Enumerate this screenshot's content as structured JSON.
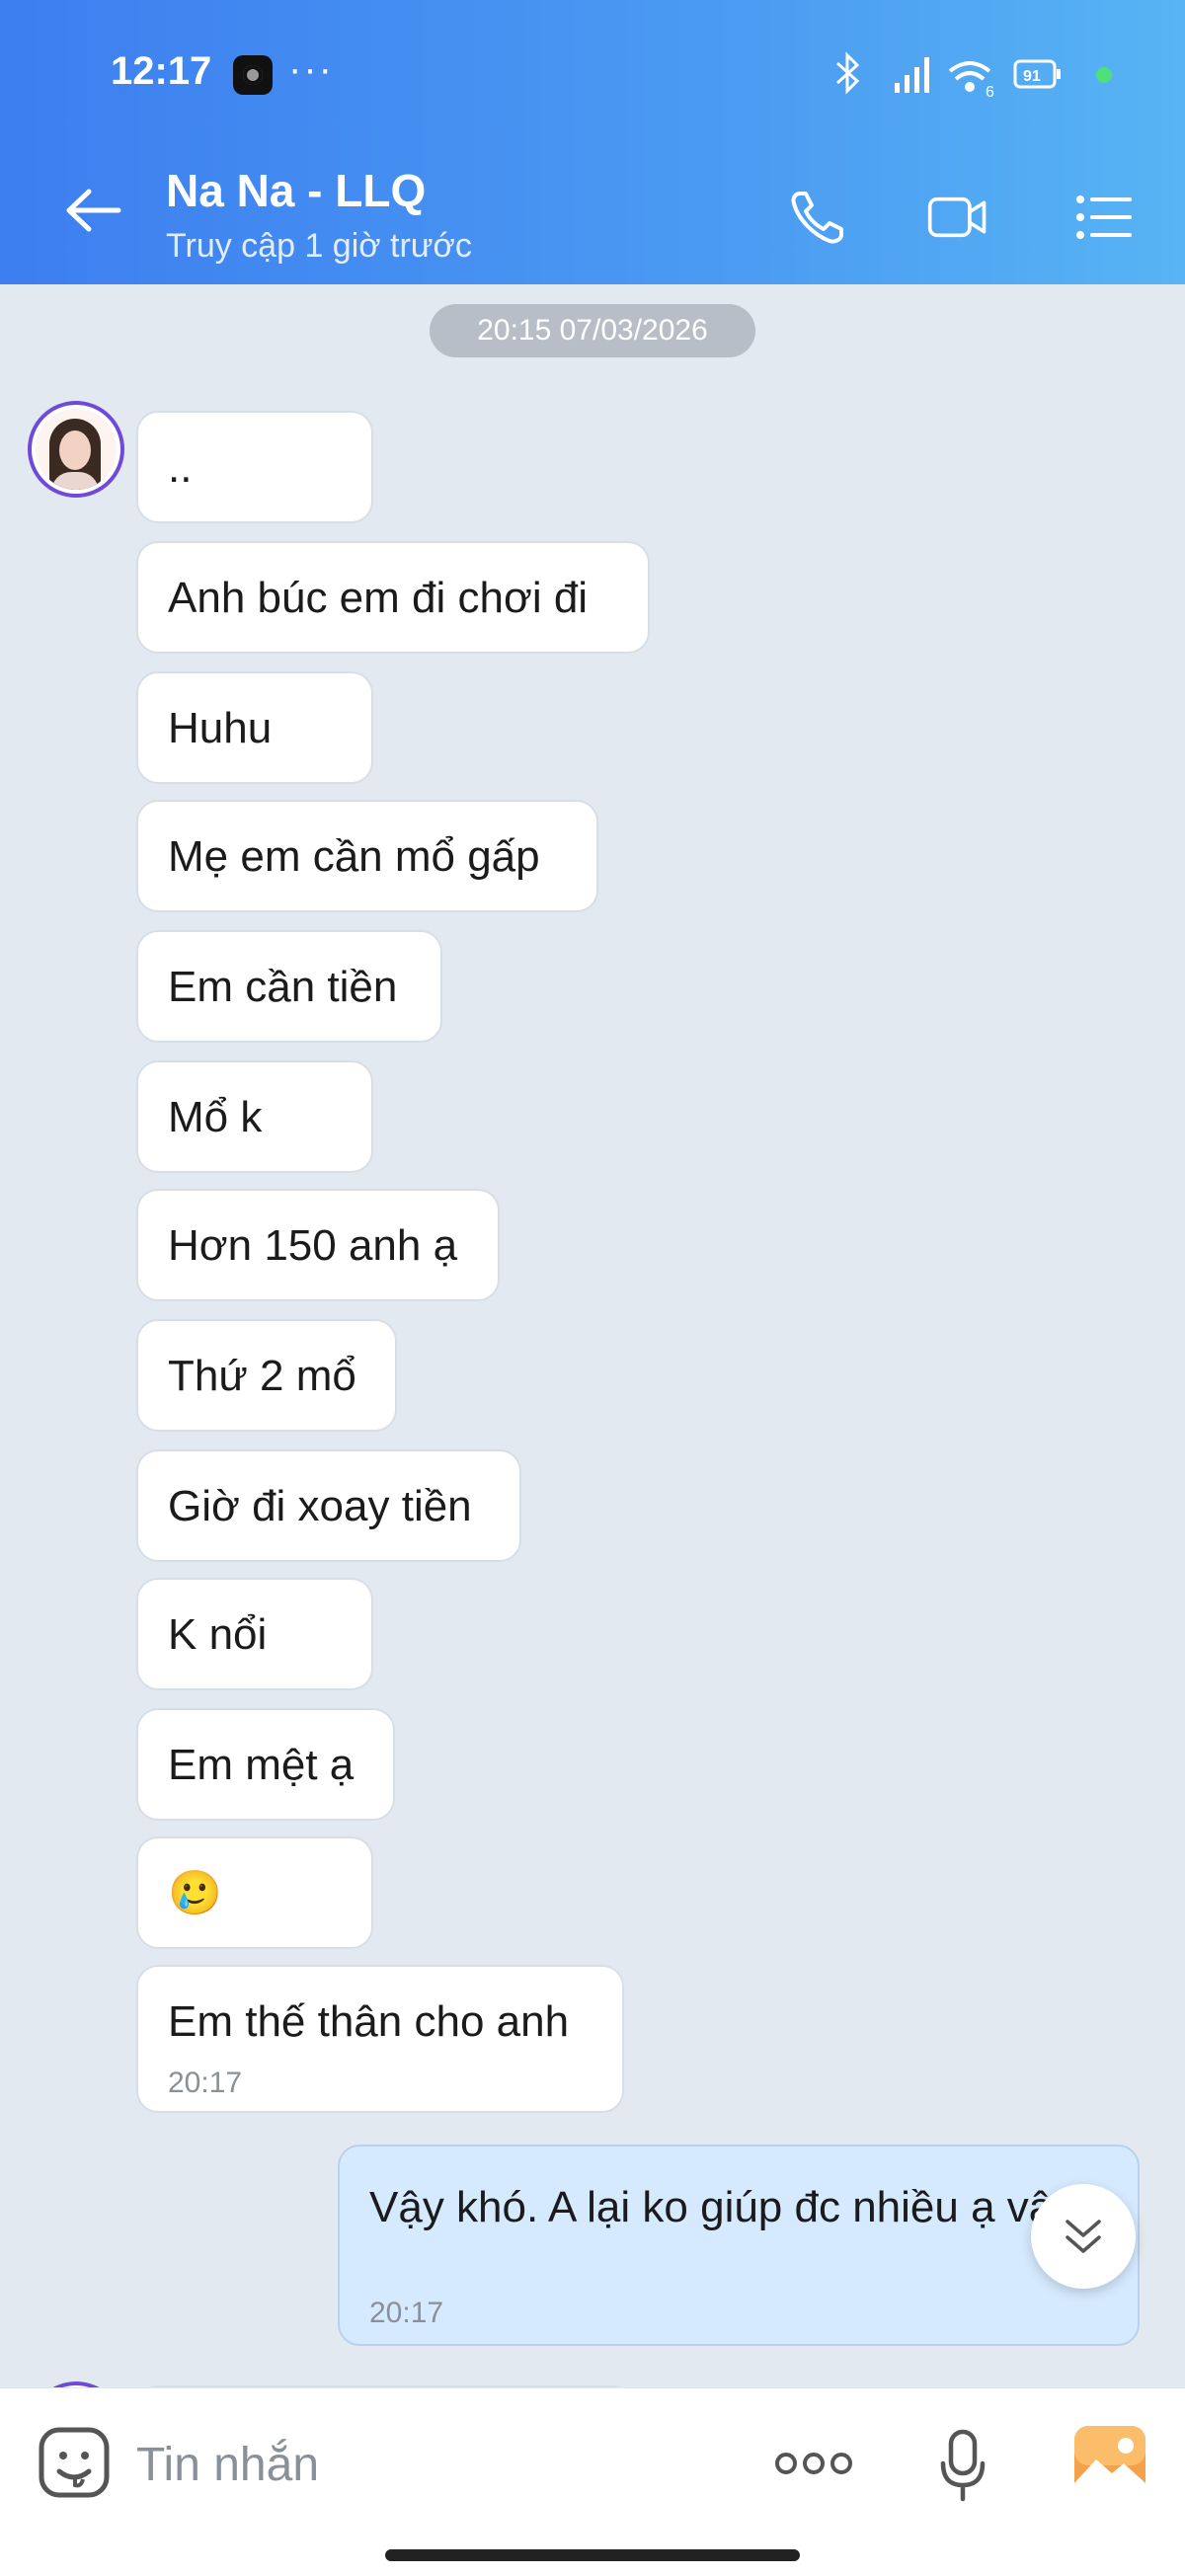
{
  "status_bar": {
    "time": "12:17",
    "more": "···",
    "battery": "91",
    "network": "6"
  },
  "header": {
    "title": "Na Na - LLQ",
    "subtitle": "Truy cập 1 giờ trước",
    "icons": [
      "back-arrow-icon",
      "phone-icon",
      "video-camera-icon",
      "list-menu-icon"
    ]
  },
  "chat": {
    "date_separator": "20:15 07/03/2026",
    "incoming": [
      {
        "text": ".."
      },
      {
        "text": "Anh búc em đi chơi đi"
      },
      {
        "text": "Huhu"
      },
      {
        "text": "Mẹ em cần mổ gấp"
      },
      {
        "text": "Em cần tiền"
      },
      {
        "text": "Mổ k"
      },
      {
        "text": "Hơn 150 anh ạ"
      },
      {
        "text": "Thứ 2 mổ"
      },
      {
        "text": "Giờ đi xoay tiền"
      },
      {
        "text": "K nổi"
      },
      {
        "text": "Em mệt ạ"
      },
      {
        "text": "🥲"
      },
      {
        "text": "Em thế thân cho anh",
        "time": "20:17"
      }
    ],
    "outgoing": {
      "text": "Vậy khó. A lại ko giúp đc nhiều ạ vậy",
      "time": "20:17"
    }
  },
  "input_bar": {
    "placeholder": "Tin nhắn",
    "icons": [
      "sticker-icon",
      "more-options-icon",
      "microphone-icon",
      "gallery-icon"
    ]
  },
  "colors": {
    "header_start": "#3d7ef0",
    "header_end": "#58b4f4",
    "chat_bg": "#e2e9f1",
    "outgoing_bubble": "#d6eaff",
    "gallery_orange": "#f5a04a"
  }
}
